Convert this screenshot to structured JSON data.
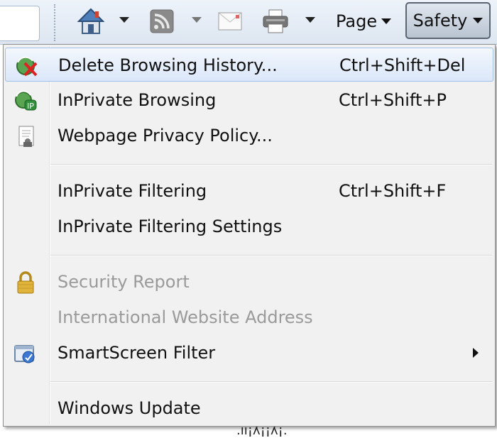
{
  "toolbar": {
    "page_label": "Page",
    "safety_label": "Safety",
    "icons": [
      "home-icon",
      "rss-feed-icon",
      "mail-icon",
      "print-icon"
    ]
  },
  "menu": {
    "items": [
      {
        "label": "Delete Browsing History...",
        "shortcut": "Ctrl+Shift+Del",
        "icon": "delete-history-icon",
        "enabled": true,
        "highlighted": true
      },
      {
        "label": "InPrivate Browsing",
        "shortcut": "Ctrl+Shift+P",
        "icon": "inprivate-icon",
        "enabled": true
      },
      {
        "label": "Webpage Privacy Policy...",
        "shortcut": "",
        "icon": "privacy-policy-icon",
        "enabled": true
      },
      {
        "label": "InPrivate Filtering",
        "shortcut": "Ctrl+Shift+F",
        "icon": "",
        "enabled": true
      },
      {
        "label": "InPrivate Filtering Settings",
        "shortcut": "",
        "icon": "",
        "enabled": true
      },
      {
        "label": "Security Report",
        "shortcut": "",
        "icon": "lock-icon",
        "enabled": false
      },
      {
        "label": "International Website Address",
        "shortcut": "",
        "icon": "",
        "enabled": false
      },
      {
        "label": "SmartScreen Filter",
        "shortcut": "",
        "icon": "smartscreen-icon",
        "enabled": true,
        "submenu": true
      },
      {
        "label": "Windows Update",
        "shortcut": "",
        "icon": "",
        "enabled": true
      }
    ]
  },
  "colors": {
    "highlight_border": "#9fc0e8",
    "disabled_text": "#9a9a9a",
    "menu_bg": "#f1f1f1"
  }
}
